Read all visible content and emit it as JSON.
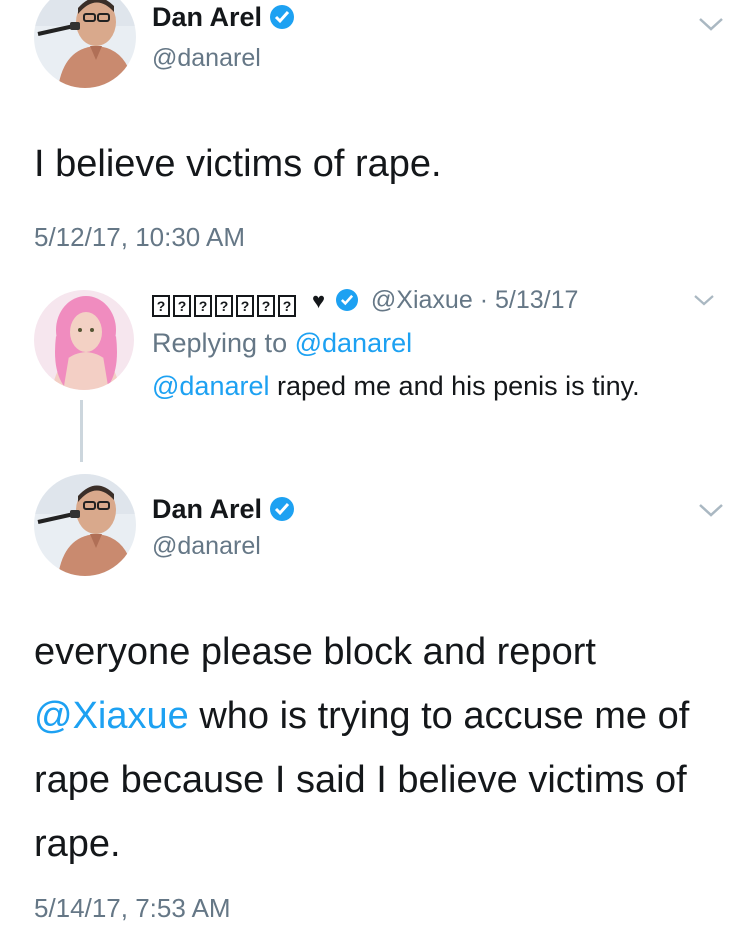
{
  "tweet1": {
    "name": "Dan Arel",
    "handle": "@danarel",
    "text": "I believe victims of rape.",
    "timestamp": "5/12/17, 10:30 AM",
    "avatar_icon": "person-at-microphone-avatar",
    "verified_icon": "verified-badge-icon",
    "menu_icon": "chevron-down-icon"
  },
  "reply": {
    "name_glyphs": [
      "?",
      "?",
      "?",
      "?",
      "?",
      "?",
      "?"
    ],
    "heart": "♥",
    "handle": "@Xiaxue",
    "separator": "·",
    "date": "5/13/17",
    "replying_prefix": "Replying to",
    "replying_to": "@danarel",
    "mention": "@danarel",
    "text": " raped me and his penis is tiny.",
    "avatar_icon": "pink-hair-woman-avatar"
  },
  "tweet2": {
    "name": "Dan Arel",
    "handle": "@danarel",
    "text_before": "everyone please block and report ",
    "mention": "@Xiaxue",
    "text_after": " who is trying to accuse me of rape because I said I believe victims of rape.",
    "timestamp": "5/14/17, 7:53 AM"
  },
  "colors": {
    "link": "#1da1f2",
    "secondary_text": "#657786",
    "verified": "#1da1f2"
  }
}
